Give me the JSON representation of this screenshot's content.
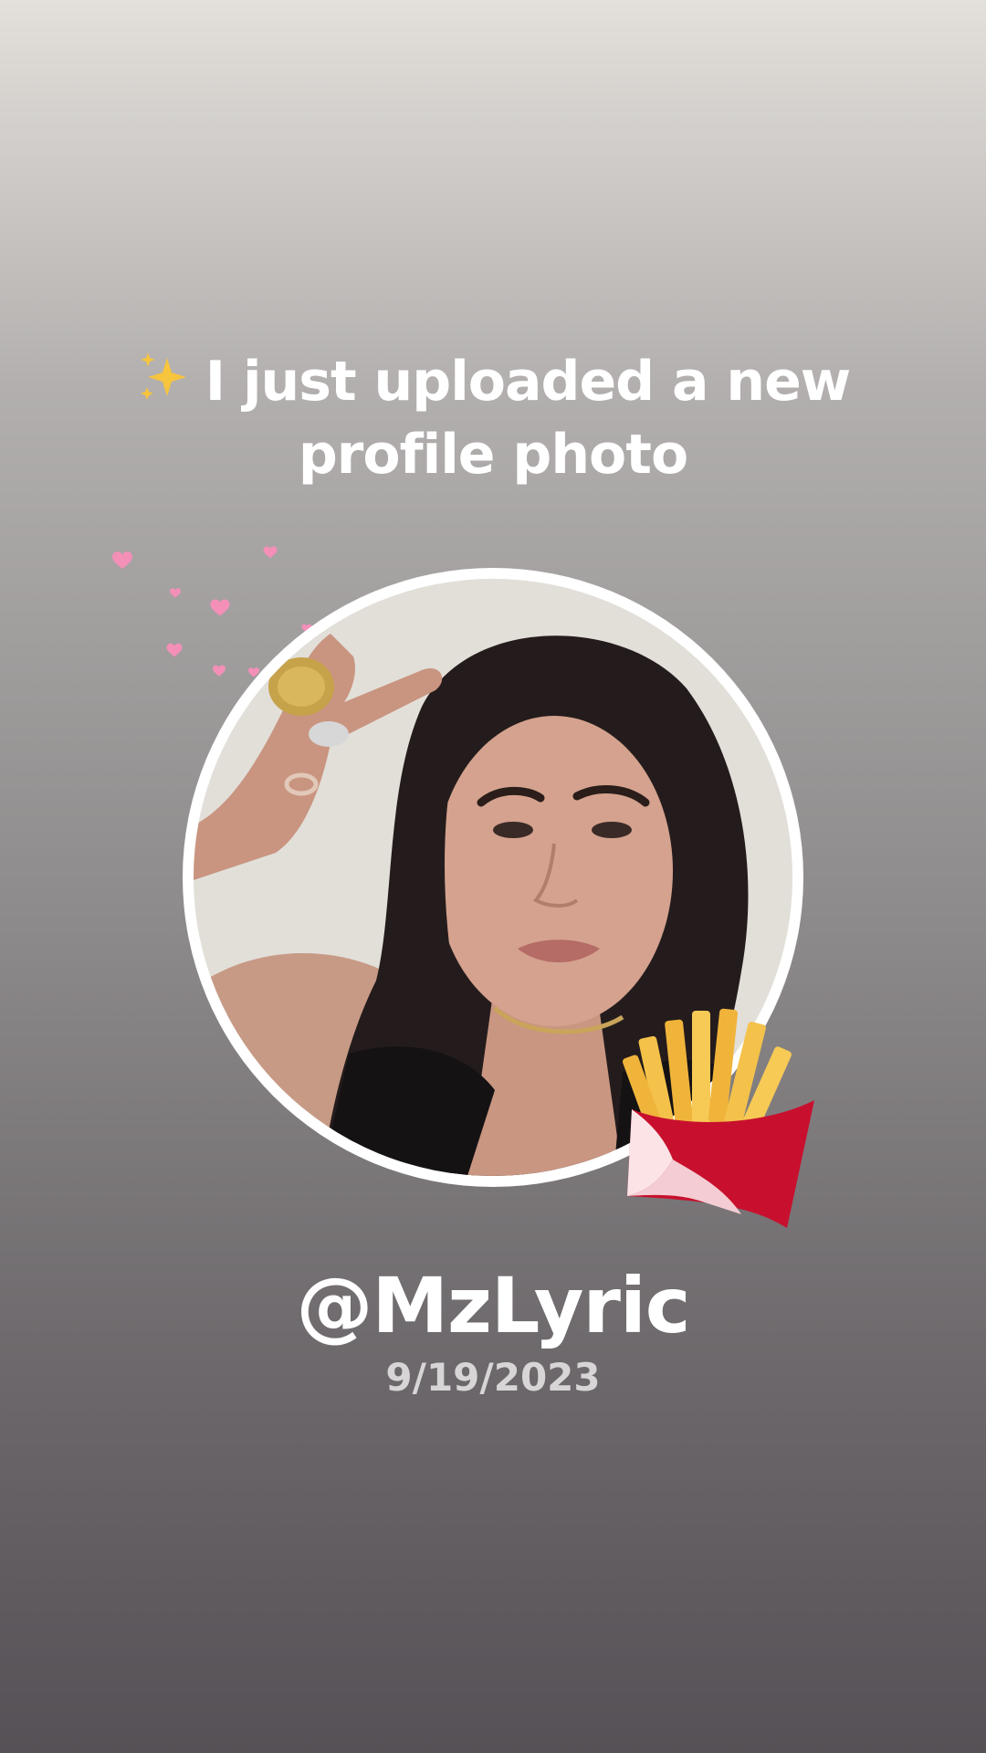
{
  "post": {
    "headline_line1": "I just uploaded a new",
    "headline_line2": "profile photo",
    "username": "@MzLyric",
    "date": "9/19/2023"
  },
  "decorations": {
    "headline_emoji": "sparkles-icon",
    "sticker": "french-fries-icon",
    "accent": "floating-hearts-icon"
  },
  "colors": {
    "text": "#ffffff",
    "date_text": "#d7d5d6",
    "hearts": "#f48fb8",
    "ring": "#ffffff",
    "fries_box": "#c8102e"
  }
}
